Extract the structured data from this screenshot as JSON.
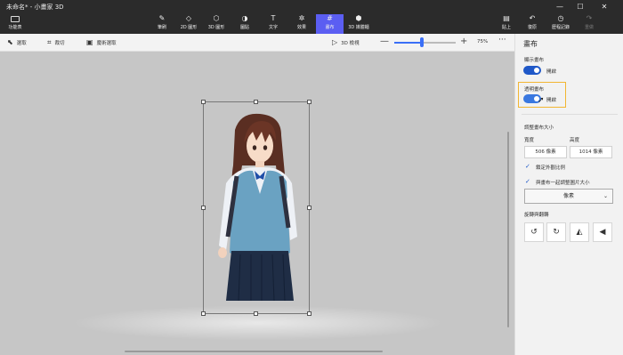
{
  "window": {
    "title": "未命名* - 小畫家 3D",
    "minimize": "—",
    "maximize": "☐",
    "close": "✕"
  },
  "menu": {
    "label": "功能表",
    "icon": "folder-icon"
  },
  "ribbon": {
    "tools": [
      {
        "label": "筆刷",
        "icon": "brush-icon",
        "glyph": "✎"
      },
      {
        "label": "2D 圖形",
        "icon": "shapes-2d-icon",
        "glyph": "◇"
      },
      {
        "label": "3D 圖形",
        "icon": "shapes-3d-icon",
        "glyph": "⬡"
      },
      {
        "label": "圖貼",
        "icon": "sticker-icon",
        "glyph": "◑"
      },
      {
        "label": "文字",
        "icon": "text-icon",
        "glyph": "T"
      },
      {
        "label": "效果",
        "icon": "effects-icon",
        "glyph": "✲"
      },
      {
        "label": "畫布",
        "icon": "canvas-icon",
        "glyph": "#"
      },
      {
        "label": "3D 媒體櫃",
        "icon": "library-3d-icon",
        "glyph": "⬢"
      }
    ],
    "active_tool": "畫布",
    "right": [
      {
        "label": "貼上",
        "icon": "paste-icon",
        "glyph": "▤"
      },
      {
        "label": "復原",
        "icon": "undo-icon",
        "glyph": "↶"
      },
      {
        "label": "歷程記錄",
        "icon": "history-icon",
        "glyph": "◷"
      },
      {
        "label": "重做",
        "icon": "redo-icon",
        "glyph": "↷"
      }
    ]
  },
  "toolbar": {
    "select_label": "選取",
    "crop_label": "裁切",
    "magic_select_label": "魔術選取",
    "view3d_label": "3D 檢視",
    "zoom_minus": "—",
    "zoom_plus": "+",
    "zoom_percent": "75%",
    "more": "···",
    "zoom_level": 0.45
  },
  "panel": {
    "title": "畫布",
    "show_canvas_label": "顯示畫布",
    "show_canvas_state": "開啟",
    "transparent_canvas_label": "透明畫布",
    "transparent_canvas_state": "開啟",
    "resize_label": "調整畫布大小",
    "width_label": "寬度",
    "height_label": "高度",
    "width_value": "506 像素",
    "height_value": "1014 像素",
    "lock_aspect_label": "鎖定外觀比例",
    "resize_with_canvas_label": "與畫布一起調整圖片大小",
    "unit_value": "像素",
    "rotate_flip_label": "旋轉與翻轉"
  },
  "colors": {
    "accent": "#5b5ef2",
    "toggle": "#1f58c8",
    "highlight": "#f2b632"
  }
}
